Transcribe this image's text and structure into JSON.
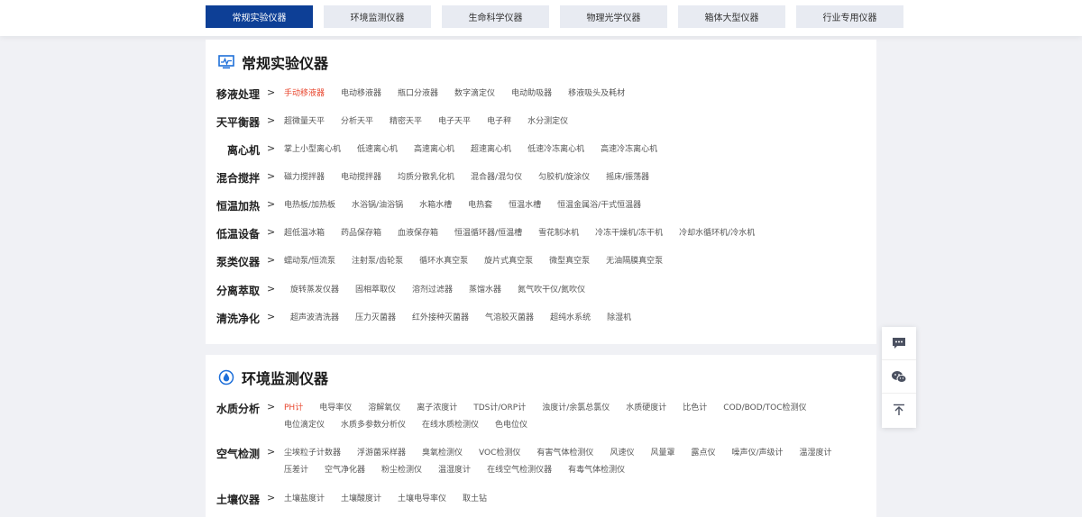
{
  "tabs": [
    "常规实验仪器",
    "环境监测仪器",
    "生命科学仪器",
    "物理光学仪器",
    "箱体大型仪器",
    "行业专用仪器"
  ],
  "section1": {
    "title": "常规实验仪器",
    "rows": [
      {
        "cat": "移液处理",
        "items": [
          "手动移液器",
          "电动移液器",
          "瓶口分液器",
          "数字滴定仪",
          "电动助吸器",
          "移液吸头及耗材"
        ]
      },
      {
        "cat": "天平衡器",
        "items": [
          "超微量天平",
          "分析天平",
          "精密天平",
          "电子天平",
          "电子秤",
          "水分测定仪"
        ]
      },
      {
        "cat": "离心机",
        "items": [
          "掌上小型离心机",
          "低速离心机",
          "高速离心机",
          "超速离心机",
          "低速冷冻离心机",
          "高速冷冻离心机"
        ]
      },
      {
        "cat": "混合搅拌",
        "items": [
          "磁力搅拌器",
          "电动搅拌器",
          "均质分散乳化机",
          "混合器/混匀仪",
          "匀胶机/旋涂仪",
          "摇床/振荡器"
        ]
      },
      {
        "cat": "恒温加热",
        "items": [
          "电热板/加热板",
          "水浴锅/油浴锅",
          "水箱水槽",
          "电热套",
          "恒温水槽",
          "恒温金属浴/干式恒温器"
        ]
      },
      {
        "cat": "低温设备",
        "items": [
          "超低温冰箱",
          "药品保存箱",
          "血液保存箱",
          "恒温循环器/恒温槽",
          "雪花制冰机",
          "冷冻干燥机/冻干机",
          "冷却水循环机/冷水机"
        ]
      },
      {
        "cat": "泵类仪器",
        "items": [
          "蠕动泵/恒流泵",
          "注射泵/齿轮泵",
          "循环水真空泵",
          "旋片式真空泵",
          "微型真空泵",
          "无油隔膜真空泵"
        ]
      },
      {
        "cat": "分离萃取",
        "items": [
          "旋转蒸发仪器",
          "固相萃取仪",
          "溶剂过滤器",
          "蒸馏水器",
          "氮气吹干仪/氮吹仪"
        ]
      },
      {
        "cat": "清洗净化",
        "items": [
          "超声波清洗器",
          "压力灭菌器",
          "红外接种灭菌器",
          "气溶胶灭菌器",
          "超纯水系统",
          "除湿机"
        ]
      }
    ]
  },
  "section2": {
    "title": "环境监测仪器",
    "rows": [
      {
        "cat": "水质分析",
        "items": [
          "PH计",
          "电导率仪",
          "溶解氧仪",
          "离子浓度计",
          "TDS计/ORP计",
          "浊度计/余氯总氯仪",
          "水质硬度计",
          "比色计",
          "COD/BOD/TOC检测仪",
          "电位滴定仪",
          "水质多参数分析仪",
          "在线水质检测仪",
          "色电位仪"
        ]
      },
      {
        "cat": "空气检测",
        "items": [
          "尘埃粒子计数器",
          "浮游菌采样器",
          "臭氧检测仪",
          "VOC检测仪",
          "有害气体检测仪",
          "风速仪",
          "风量罩",
          "露点仪",
          "噪声仪/声级计",
          "温湿度计",
          "压差计",
          "空气净化器",
          "粉尘检测仪",
          "温湿度计",
          "在线空气检测仪器",
          "有毒气体检测仪"
        ]
      },
      {
        "cat": "土壤仪器",
        "items": [
          "土壤盐度计",
          "土壤酸度计",
          "土壤电导率仪",
          "取土钻"
        ]
      }
    ]
  },
  "arrow": ">",
  "colors": {
    "active_tab": "#0d3f96",
    "highlight": "#e8462e",
    "icon": "#1e6fd9"
  },
  "icons": [
    "chart-monitor-icon",
    "water-drop-icon",
    "chat-icon",
    "wechat-icon",
    "back-to-top-icon"
  ]
}
